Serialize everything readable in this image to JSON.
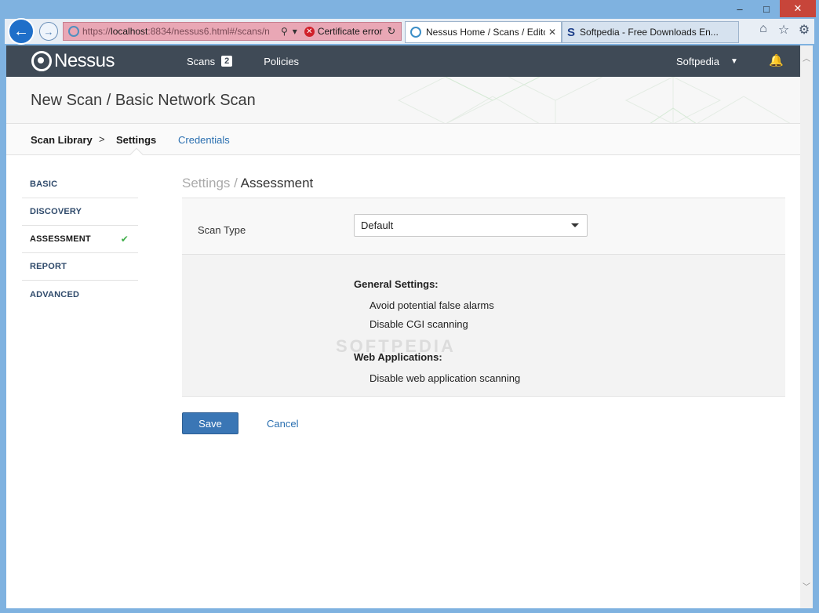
{
  "window": {
    "controls": [
      "–",
      "□",
      "✕"
    ]
  },
  "browser": {
    "address": {
      "url_prefix": "https://",
      "url_host": "localhost",
      "url_rest": ":8834/nessus6.html#/scans/n",
      "cert_error": "Certificate error"
    },
    "tabs": [
      {
        "label": "Nessus Home / Scans / Editor",
        "active": true
      },
      {
        "label": "Softpedia - Free Downloads En...",
        "active": false
      }
    ]
  },
  "header": {
    "logo_text": "Nessus",
    "nav": [
      {
        "label": "Scans",
        "badge": "2"
      },
      {
        "label": "Policies"
      }
    ],
    "user": "Softpedia"
  },
  "page": {
    "title": "New Scan / Basic Network Scan"
  },
  "subnav": {
    "library": "Scan Library",
    "separator": ">",
    "current": "Settings",
    "credentials": "Credentials"
  },
  "sidemenu": {
    "items": [
      {
        "label": "BASIC"
      },
      {
        "label": "DISCOVERY"
      },
      {
        "label": "ASSESSMENT",
        "checked": true
      },
      {
        "label": "REPORT"
      },
      {
        "label": "ADVANCED"
      }
    ]
  },
  "content": {
    "title_muted": "Settings /",
    "title_main": "Assessment",
    "scan_type_label": "Scan Type",
    "scan_type_value": "Default",
    "general_heading": "General Settings:",
    "general_items": [
      "Avoid potential false alarms",
      "Disable CGI scanning"
    ],
    "webapp_heading": "Web Applications:",
    "webapp_items": [
      "Disable web application scanning"
    ],
    "watermark": "SOFTPEDIA"
  },
  "actions": {
    "save": "Save",
    "cancel": "Cancel"
  }
}
